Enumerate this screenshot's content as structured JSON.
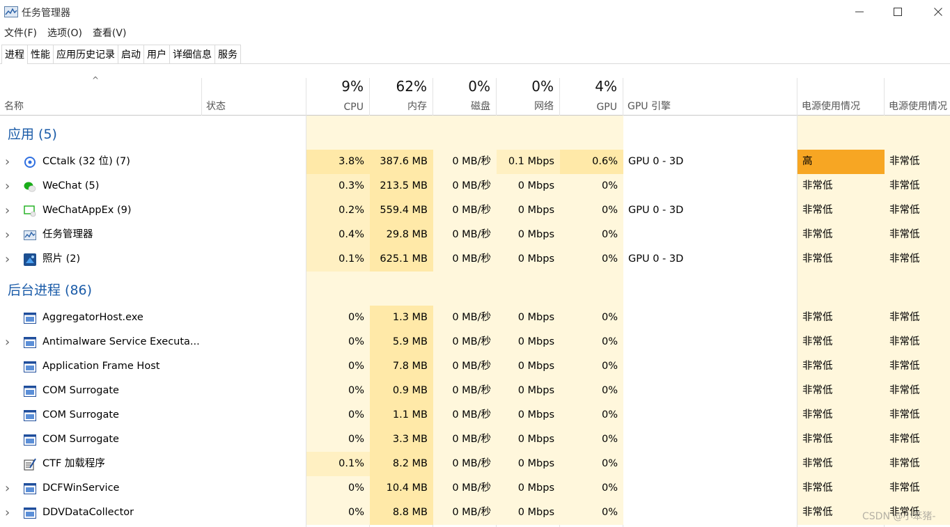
{
  "window": {
    "title": "任务管理器"
  },
  "menu": [
    "文件(F)",
    "选项(O)",
    "查看(V)"
  ],
  "tabs": [
    "进程",
    "性能",
    "应用历史记录",
    "启动",
    "用户",
    "详细信息",
    "服务"
  ],
  "header": {
    "name_label": "名称",
    "status_label": "状态",
    "cpu": {
      "pct": "9%",
      "label": "CPU"
    },
    "mem": {
      "pct": "62%",
      "label": "内存"
    },
    "disk": {
      "pct": "0%",
      "label": "磁盘"
    },
    "net": {
      "pct": "0%",
      "label": "网络"
    },
    "gpu": {
      "pct": "4%",
      "label": "GPU"
    },
    "gpu_engine_label": "GPU 引擎",
    "power_label": "电源使用情况",
    "power_trend_label": "电源使用情况"
  },
  "groups": [
    {
      "title": "应用 (5)",
      "rows": [
        {
          "name": "CCtalk (32 位) (7)",
          "expand": true,
          "icon": "cctalk-icon",
          "cpu": "3.8%",
          "mem": "387.6 MB",
          "disk": "0 MB/秒",
          "net": "0.1 Mbps",
          "gpu": "0.6%",
          "gpu_engine": "GPU 0 - 3D",
          "power": "高",
          "power_trend": "非常低"
        },
        {
          "name": "WeChat (5)",
          "expand": true,
          "icon": "wechat-icon",
          "cpu": "0.3%",
          "mem": "213.5 MB",
          "disk": "0 MB/秒",
          "net": "0 Mbps",
          "gpu": "0%",
          "gpu_engine": "",
          "power": "非常低",
          "power_trend": "非常低"
        },
        {
          "name": "WeChatAppEx (9)",
          "expand": true,
          "icon": "wechatappex-icon",
          "cpu": "0.2%",
          "mem": "559.4 MB",
          "disk": "0 MB/秒",
          "net": "0 Mbps",
          "gpu": "0%",
          "gpu_engine": "GPU 0 - 3D",
          "power": "非常低",
          "power_trend": "非常低"
        },
        {
          "name": "任务管理器",
          "expand": true,
          "icon": "task-manager-icon",
          "cpu": "0.4%",
          "mem": "29.8 MB",
          "disk": "0 MB/秒",
          "net": "0 Mbps",
          "gpu": "0%",
          "gpu_engine": "",
          "power": "非常低",
          "power_trend": "非常低"
        },
        {
          "name": "照片 (2)",
          "expand": true,
          "icon": "photos-icon",
          "cpu": "0.1%",
          "mem": "625.1 MB",
          "disk": "0 MB/秒",
          "net": "0 Mbps",
          "gpu": "0%",
          "gpu_engine": "GPU 0 - 3D",
          "power": "非常低",
          "power_trend": "非常低"
        }
      ]
    },
    {
      "title": "后台进程 (86)",
      "rows": [
        {
          "name": "AggregatorHost.exe",
          "expand": false,
          "icon": "process-icon",
          "cpu": "0%",
          "mem": "1.3 MB",
          "disk": "0 MB/秒",
          "net": "0 Mbps",
          "gpu": "0%",
          "gpu_engine": "",
          "power": "非常低",
          "power_trend": "非常低"
        },
        {
          "name": "Antimalware Service Executa...",
          "expand": true,
          "icon": "process-icon",
          "cpu": "0%",
          "mem": "5.9 MB",
          "disk": "0 MB/秒",
          "net": "0 Mbps",
          "gpu": "0%",
          "gpu_engine": "",
          "power": "非常低",
          "power_trend": "非常低"
        },
        {
          "name": "Application Frame Host",
          "expand": false,
          "icon": "process-icon",
          "cpu": "0%",
          "mem": "7.8 MB",
          "disk": "0 MB/秒",
          "net": "0 Mbps",
          "gpu": "0%",
          "gpu_engine": "",
          "power": "非常低",
          "power_trend": "非常低"
        },
        {
          "name": "COM Surrogate",
          "expand": false,
          "icon": "process-icon",
          "cpu": "0%",
          "mem": "0.9 MB",
          "disk": "0 MB/秒",
          "net": "0 Mbps",
          "gpu": "0%",
          "gpu_engine": "",
          "power": "非常低",
          "power_trend": "非常低"
        },
        {
          "name": "COM Surrogate",
          "expand": false,
          "icon": "process-icon",
          "cpu": "0%",
          "mem": "1.1 MB",
          "disk": "0 MB/秒",
          "net": "0 Mbps",
          "gpu": "0%",
          "gpu_engine": "",
          "power": "非常低",
          "power_trend": "非常低"
        },
        {
          "name": "COM Surrogate",
          "expand": false,
          "icon": "process-icon",
          "cpu": "0%",
          "mem": "3.3 MB",
          "disk": "0 MB/秒",
          "net": "0 Mbps",
          "gpu": "0%",
          "gpu_engine": "",
          "power": "非常低",
          "power_trend": "非常低"
        },
        {
          "name": "CTF 加载程序",
          "expand": false,
          "icon": "ctf-loader-icon",
          "cpu": "0.1%",
          "mem": "8.2 MB",
          "disk": "0 MB/秒",
          "net": "0 Mbps",
          "gpu": "0%",
          "gpu_engine": "",
          "power": "非常低",
          "power_trend": "非常低"
        },
        {
          "name": "DCFWinService",
          "expand": true,
          "icon": "process-icon",
          "cpu": "0%",
          "mem": "10.4 MB",
          "disk": "0 MB/秒",
          "net": "0 Mbps",
          "gpu": "0%",
          "gpu_engine": "",
          "power": "非常低",
          "power_trend": "非常低"
        },
        {
          "name": "DDVDataCollector",
          "expand": true,
          "icon": "process-icon",
          "cpu": "0%",
          "mem": "8.8 MB",
          "disk": "0 MB/秒",
          "net": "0 Mbps",
          "gpu": "0%",
          "gpu_engine": "",
          "power": "非常低",
          "power_trend": "非常低"
        }
      ]
    }
  ],
  "colors": {
    "light": "#fff7dc",
    "medium": "#fff0c2",
    "strong": "#ffe9a8",
    "high_power": "#f7a623",
    "group_title": "#1a5ba8"
  },
  "watermark": "CSDN @小笨猪-"
}
